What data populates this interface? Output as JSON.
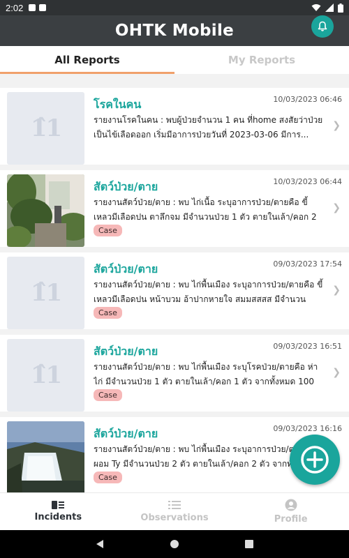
{
  "status_bar": {
    "time": "2:02"
  },
  "app_bar": {
    "title": "OHTK Mobile"
  },
  "tabs": [
    {
      "label": "All Reports",
      "active": true
    },
    {
      "label": "My Reports",
      "active": false
    }
  ],
  "reports": [
    {
      "title": "โรคในคน",
      "date": "10/03/2023 06:46",
      "description": "รายงานโรคในคน : พบผู้ป่วยจำนวน 1 คน ที่home สงสัยว่าป่วยเป็นไข้เลือดออก เริ่มมีอาการป่วยวันที่ 2023-03-06 มีการ...",
      "badge": "",
      "image": "placeholder"
    },
    {
      "title": "สัตว์ป่วย/ตาย",
      "date": "10/03/2023 06:44",
      "description": "รายงานสัตว์ป่วย/ตาย : พบ ไก่เนื้อ ระบุอาการป่วย/ตายคือ ขี้เหลวมีเลือดปน ตาลึกจม มีจำนวนป่วย 1 ตัว ตายในเล้า/คอก 2 ตัว ...",
      "badge": "Case",
      "image": "garden"
    },
    {
      "title": "สัตว์ป่วย/ตาย",
      "date": "09/03/2023 17:54",
      "description": "รายงานสัตว์ป่วย/ตาย : พบ ไก่พื้นเมือง ระบุอาการป่วย/ตายคือ ขี้เหลวมีเลือดปน หน้าบวม อ้าปากหายใจ สมมสสสส มีจำนวนป่วย...",
      "badge": "Case",
      "image": "placeholder"
    },
    {
      "title": "สัตว์ป่วย/ตาย",
      "date": "09/03/2023 16:51",
      "description": "รายงานสัตว์ป่วย/ตาย : พบ ไก่พื้นเมือง ระบุโรคป่วย/ตายคือ ห่าไก่ มีจำนวนป่วย 1 ตัว ตายในเล้า/คอก 1 ตัว จากทั้งหมด 100 ...",
      "badge": "Case",
      "image": "placeholder"
    },
    {
      "title": "สัตว์ป่วย/ตาย",
      "date": "09/03/2023 16:16",
      "description": "รายงานสัตว์ป่วย/ตาย : พบ ไก่พื้นเมือง ระบุอาการป่วย/ตายคือ ผอม Ty มีจำนวนป่วย 2 ตัว ตายในเล้า/คอก 2 ตัว จากทั้งหมด...",
      "badge": "Case",
      "image": "waterfall"
    }
  ],
  "bottom_nav": [
    {
      "label": "Incidents",
      "icon": "incidents-icon",
      "active": true
    },
    {
      "label": "Observations",
      "icon": "list-icon",
      "active": false
    },
    {
      "label": "Profile",
      "icon": "profile-icon",
      "active": false
    }
  ],
  "colors": {
    "accent": "#1aa59c",
    "tab_underline": "#f0a06b",
    "case_badge": "#f6b8b8",
    "app_bar": "#3b3f42"
  }
}
